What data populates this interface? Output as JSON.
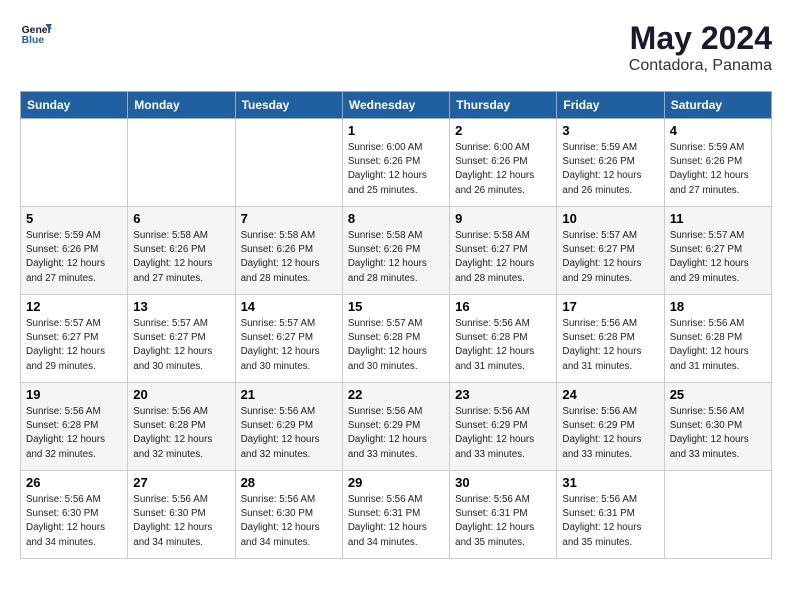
{
  "logo": {
    "line1": "General",
    "line2": "Blue"
  },
  "title": "May 2024",
  "subtitle": "Contadora, Panama",
  "headers": [
    "Sunday",
    "Monday",
    "Tuesday",
    "Wednesday",
    "Thursday",
    "Friday",
    "Saturday"
  ],
  "weeks": [
    [
      {
        "day": "",
        "info": ""
      },
      {
        "day": "",
        "info": ""
      },
      {
        "day": "",
        "info": ""
      },
      {
        "day": "1",
        "info": "Sunrise: 6:00 AM\nSunset: 6:26 PM\nDaylight: 12 hours\nand 25 minutes."
      },
      {
        "day": "2",
        "info": "Sunrise: 6:00 AM\nSunset: 6:26 PM\nDaylight: 12 hours\nand 26 minutes."
      },
      {
        "day": "3",
        "info": "Sunrise: 5:59 AM\nSunset: 6:26 PM\nDaylight: 12 hours\nand 26 minutes."
      },
      {
        "day": "4",
        "info": "Sunrise: 5:59 AM\nSunset: 6:26 PM\nDaylight: 12 hours\nand 27 minutes."
      }
    ],
    [
      {
        "day": "5",
        "info": "Sunrise: 5:59 AM\nSunset: 6:26 PM\nDaylight: 12 hours\nand 27 minutes."
      },
      {
        "day": "6",
        "info": "Sunrise: 5:58 AM\nSunset: 6:26 PM\nDaylight: 12 hours\nand 27 minutes."
      },
      {
        "day": "7",
        "info": "Sunrise: 5:58 AM\nSunset: 6:26 PM\nDaylight: 12 hours\nand 28 minutes."
      },
      {
        "day": "8",
        "info": "Sunrise: 5:58 AM\nSunset: 6:26 PM\nDaylight: 12 hours\nand 28 minutes."
      },
      {
        "day": "9",
        "info": "Sunrise: 5:58 AM\nSunset: 6:27 PM\nDaylight: 12 hours\nand 28 minutes."
      },
      {
        "day": "10",
        "info": "Sunrise: 5:57 AM\nSunset: 6:27 PM\nDaylight: 12 hours\nand 29 minutes."
      },
      {
        "day": "11",
        "info": "Sunrise: 5:57 AM\nSunset: 6:27 PM\nDaylight: 12 hours\nand 29 minutes."
      }
    ],
    [
      {
        "day": "12",
        "info": "Sunrise: 5:57 AM\nSunset: 6:27 PM\nDaylight: 12 hours\nand 29 minutes."
      },
      {
        "day": "13",
        "info": "Sunrise: 5:57 AM\nSunset: 6:27 PM\nDaylight: 12 hours\nand 30 minutes."
      },
      {
        "day": "14",
        "info": "Sunrise: 5:57 AM\nSunset: 6:27 PM\nDaylight: 12 hours\nand 30 minutes."
      },
      {
        "day": "15",
        "info": "Sunrise: 5:57 AM\nSunset: 6:28 PM\nDaylight: 12 hours\nand 30 minutes."
      },
      {
        "day": "16",
        "info": "Sunrise: 5:56 AM\nSunset: 6:28 PM\nDaylight: 12 hours\nand 31 minutes."
      },
      {
        "day": "17",
        "info": "Sunrise: 5:56 AM\nSunset: 6:28 PM\nDaylight: 12 hours\nand 31 minutes."
      },
      {
        "day": "18",
        "info": "Sunrise: 5:56 AM\nSunset: 6:28 PM\nDaylight: 12 hours\nand 31 minutes."
      }
    ],
    [
      {
        "day": "19",
        "info": "Sunrise: 5:56 AM\nSunset: 6:28 PM\nDaylight: 12 hours\nand 32 minutes."
      },
      {
        "day": "20",
        "info": "Sunrise: 5:56 AM\nSunset: 6:28 PM\nDaylight: 12 hours\nand 32 minutes."
      },
      {
        "day": "21",
        "info": "Sunrise: 5:56 AM\nSunset: 6:29 PM\nDaylight: 12 hours\nand 32 minutes."
      },
      {
        "day": "22",
        "info": "Sunrise: 5:56 AM\nSunset: 6:29 PM\nDaylight: 12 hours\nand 33 minutes."
      },
      {
        "day": "23",
        "info": "Sunrise: 5:56 AM\nSunset: 6:29 PM\nDaylight: 12 hours\nand 33 minutes."
      },
      {
        "day": "24",
        "info": "Sunrise: 5:56 AM\nSunset: 6:29 PM\nDaylight: 12 hours\nand 33 minutes."
      },
      {
        "day": "25",
        "info": "Sunrise: 5:56 AM\nSunset: 6:30 PM\nDaylight: 12 hours\nand 33 minutes."
      }
    ],
    [
      {
        "day": "26",
        "info": "Sunrise: 5:56 AM\nSunset: 6:30 PM\nDaylight: 12 hours\nand 34 minutes."
      },
      {
        "day": "27",
        "info": "Sunrise: 5:56 AM\nSunset: 6:30 PM\nDaylight: 12 hours\nand 34 minutes."
      },
      {
        "day": "28",
        "info": "Sunrise: 5:56 AM\nSunset: 6:30 PM\nDaylight: 12 hours\nand 34 minutes."
      },
      {
        "day": "29",
        "info": "Sunrise: 5:56 AM\nSunset: 6:31 PM\nDaylight: 12 hours\nand 34 minutes."
      },
      {
        "day": "30",
        "info": "Sunrise: 5:56 AM\nSunset: 6:31 PM\nDaylight: 12 hours\nand 35 minutes."
      },
      {
        "day": "31",
        "info": "Sunrise: 5:56 AM\nSunset: 6:31 PM\nDaylight: 12 hours\nand 35 minutes."
      },
      {
        "day": "",
        "info": ""
      }
    ]
  ]
}
